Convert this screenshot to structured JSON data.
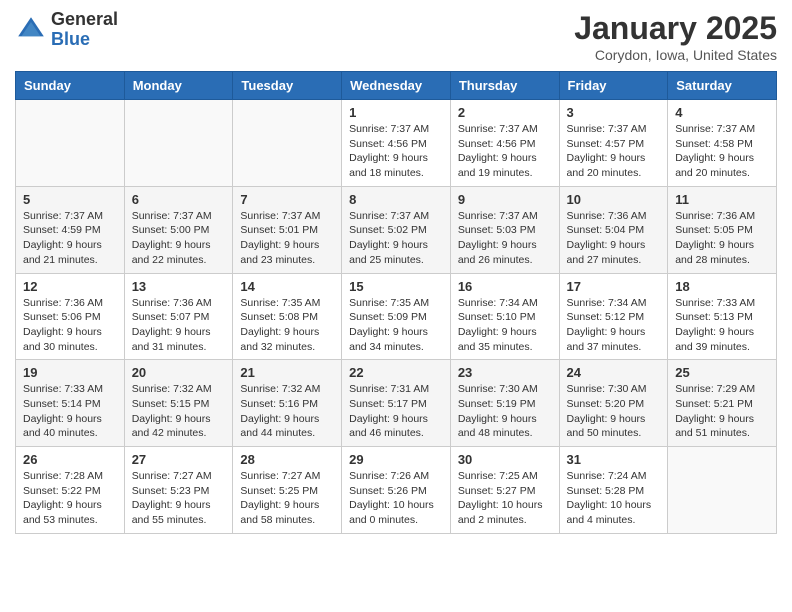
{
  "header": {
    "logo_general": "General",
    "logo_blue": "Blue",
    "title": "January 2025",
    "location": "Corydon, Iowa, United States"
  },
  "days_of_week": [
    "Sunday",
    "Monday",
    "Tuesday",
    "Wednesday",
    "Thursday",
    "Friday",
    "Saturday"
  ],
  "weeks": [
    [
      {
        "day": "",
        "info": ""
      },
      {
        "day": "",
        "info": ""
      },
      {
        "day": "",
        "info": ""
      },
      {
        "day": "1",
        "info": "Sunrise: 7:37 AM\nSunset: 4:56 PM\nDaylight: 9 hours\nand 18 minutes."
      },
      {
        "day": "2",
        "info": "Sunrise: 7:37 AM\nSunset: 4:56 PM\nDaylight: 9 hours\nand 19 minutes."
      },
      {
        "day": "3",
        "info": "Sunrise: 7:37 AM\nSunset: 4:57 PM\nDaylight: 9 hours\nand 20 minutes."
      },
      {
        "day": "4",
        "info": "Sunrise: 7:37 AM\nSunset: 4:58 PM\nDaylight: 9 hours\nand 20 minutes."
      }
    ],
    [
      {
        "day": "5",
        "info": "Sunrise: 7:37 AM\nSunset: 4:59 PM\nDaylight: 9 hours\nand 21 minutes."
      },
      {
        "day": "6",
        "info": "Sunrise: 7:37 AM\nSunset: 5:00 PM\nDaylight: 9 hours\nand 22 minutes."
      },
      {
        "day": "7",
        "info": "Sunrise: 7:37 AM\nSunset: 5:01 PM\nDaylight: 9 hours\nand 23 minutes."
      },
      {
        "day": "8",
        "info": "Sunrise: 7:37 AM\nSunset: 5:02 PM\nDaylight: 9 hours\nand 25 minutes."
      },
      {
        "day": "9",
        "info": "Sunrise: 7:37 AM\nSunset: 5:03 PM\nDaylight: 9 hours\nand 26 minutes."
      },
      {
        "day": "10",
        "info": "Sunrise: 7:36 AM\nSunset: 5:04 PM\nDaylight: 9 hours\nand 27 minutes."
      },
      {
        "day": "11",
        "info": "Sunrise: 7:36 AM\nSunset: 5:05 PM\nDaylight: 9 hours\nand 28 minutes."
      }
    ],
    [
      {
        "day": "12",
        "info": "Sunrise: 7:36 AM\nSunset: 5:06 PM\nDaylight: 9 hours\nand 30 minutes."
      },
      {
        "day": "13",
        "info": "Sunrise: 7:36 AM\nSunset: 5:07 PM\nDaylight: 9 hours\nand 31 minutes."
      },
      {
        "day": "14",
        "info": "Sunrise: 7:35 AM\nSunset: 5:08 PM\nDaylight: 9 hours\nand 32 minutes."
      },
      {
        "day": "15",
        "info": "Sunrise: 7:35 AM\nSunset: 5:09 PM\nDaylight: 9 hours\nand 34 minutes."
      },
      {
        "day": "16",
        "info": "Sunrise: 7:34 AM\nSunset: 5:10 PM\nDaylight: 9 hours\nand 35 minutes."
      },
      {
        "day": "17",
        "info": "Sunrise: 7:34 AM\nSunset: 5:12 PM\nDaylight: 9 hours\nand 37 minutes."
      },
      {
        "day": "18",
        "info": "Sunrise: 7:33 AM\nSunset: 5:13 PM\nDaylight: 9 hours\nand 39 minutes."
      }
    ],
    [
      {
        "day": "19",
        "info": "Sunrise: 7:33 AM\nSunset: 5:14 PM\nDaylight: 9 hours\nand 40 minutes."
      },
      {
        "day": "20",
        "info": "Sunrise: 7:32 AM\nSunset: 5:15 PM\nDaylight: 9 hours\nand 42 minutes."
      },
      {
        "day": "21",
        "info": "Sunrise: 7:32 AM\nSunset: 5:16 PM\nDaylight: 9 hours\nand 44 minutes."
      },
      {
        "day": "22",
        "info": "Sunrise: 7:31 AM\nSunset: 5:17 PM\nDaylight: 9 hours\nand 46 minutes."
      },
      {
        "day": "23",
        "info": "Sunrise: 7:30 AM\nSunset: 5:19 PM\nDaylight: 9 hours\nand 48 minutes."
      },
      {
        "day": "24",
        "info": "Sunrise: 7:30 AM\nSunset: 5:20 PM\nDaylight: 9 hours\nand 50 minutes."
      },
      {
        "day": "25",
        "info": "Sunrise: 7:29 AM\nSunset: 5:21 PM\nDaylight: 9 hours\nand 51 minutes."
      }
    ],
    [
      {
        "day": "26",
        "info": "Sunrise: 7:28 AM\nSunset: 5:22 PM\nDaylight: 9 hours\nand 53 minutes."
      },
      {
        "day": "27",
        "info": "Sunrise: 7:27 AM\nSunset: 5:23 PM\nDaylight: 9 hours\nand 55 minutes."
      },
      {
        "day": "28",
        "info": "Sunrise: 7:27 AM\nSunset: 5:25 PM\nDaylight: 9 hours\nand 58 minutes."
      },
      {
        "day": "29",
        "info": "Sunrise: 7:26 AM\nSunset: 5:26 PM\nDaylight: 10 hours\nand 0 minutes."
      },
      {
        "day": "30",
        "info": "Sunrise: 7:25 AM\nSunset: 5:27 PM\nDaylight: 10 hours\nand 2 minutes."
      },
      {
        "day": "31",
        "info": "Sunrise: 7:24 AM\nSunset: 5:28 PM\nDaylight: 10 hours\nand 4 minutes."
      },
      {
        "day": "",
        "info": ""
      }
    ]
  ]
}
